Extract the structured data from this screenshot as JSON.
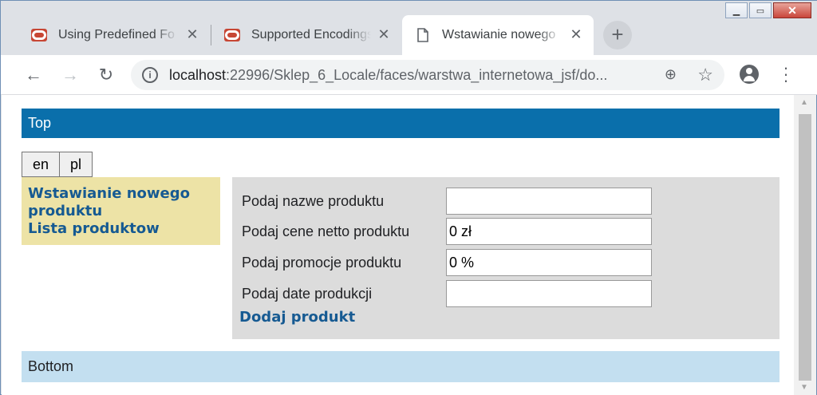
{
  "browser": {
    "tabs": [
      {
        "title": "Using Predefined Fo",
        "favicon": "oracle-icon"
      },
      {
        "title": "Supported Encodings",
        "favicon": "oracle-icon"
      },
      {
        "title": "Wstawianie nowego",
        "favicon": "document-icon"
      }
    ],
    "url_host": "localhost",
    "url_rest": ":22996/Sklep_6_Locale/faces/warstwa_internetowa_jsf/do..."
  },
  "page": {
    "top_label": "Top",
    "lang_buttons": [
      "en",
      "pl"
    ],
    "menu_links": [
      "Wstawianie nowego produktu",
      "Lista produktow"
    ],
    "form": {
      "fields": [
        {
          "label": "Podaj nazwe produktu",
          "value": ""
        },
        {
          "label": "Podaj cene netto produktu",
          "value": "0 zł"
        },
        {
          "label": "Podaj promocje produktu",
          "value": "0 %"
        },
        {
          "label": "Podaj date produkcji",
          "value": ""
        }
      ],
      "submit_label": "Dodaj produkt"
    },
    "bottom_label": "Bottom"
  },
  "colors": {
    "top_bar": "#0a6fab",
    "menu_bg": "#ede3a6",
    "form_bg": "#dcdcdc",
    "bottom_bar": "#c3dff0",
    "link": "#165a92"
  }
}
